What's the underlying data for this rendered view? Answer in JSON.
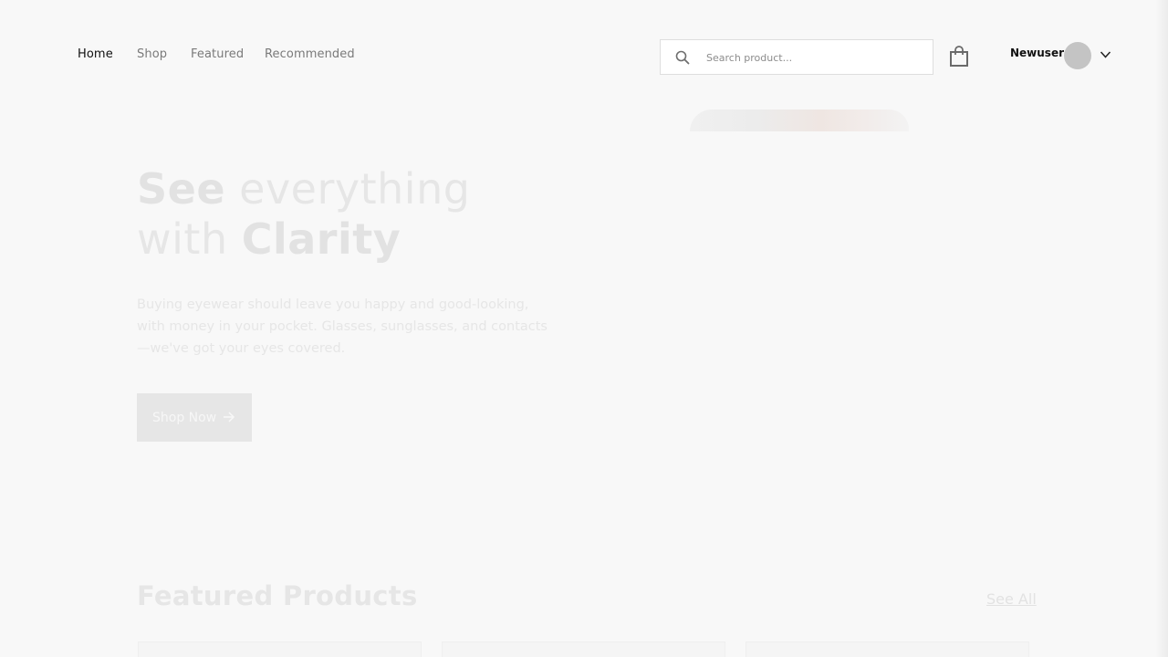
{
  "nav": {
    "links": [
      {
        "label": "Home"
      },
      {
        "label": "Shop"
      },
      {
        "label": "Featured"
      },
      {
        "label": "Recommended"
      }
    ]
  },
  "search": {
    "placeholder": "Search product..."
  },
  "user": {
    "name": "Newuser"
  },
  "hero": {
    "title_line1_bold": "See",
    "title_line1_rest": " everything",
    "title_line2_start": "with ",
    "title_line2_bold": "Clarity",
    "description": "Buying eyewear should leave you happy and good-looking, with money in your pocket. Glasses, sunglasses, and contacts—we've got your eyes covered.",
    "cta_label": "Shop Now"
  },
  "featured": {
    "title": "Featured Products",
    "see_all_label": "See All"
  },
  "icons": {
    "search": "search-icon",
    "bag": "shopping-bag-icon",
    "chevron": "chevron-down-icon",
    "arrow": "arrow-right-icon"
  },
  "colors": {
    "page_background": "#f8f8f8",
    "nav_active": "#101010",
    "nav_inactive": "#7a7a7a",
    "avatar": "#c4c4c4",
    "faded_text": "#e6e6e6"
  }
}
